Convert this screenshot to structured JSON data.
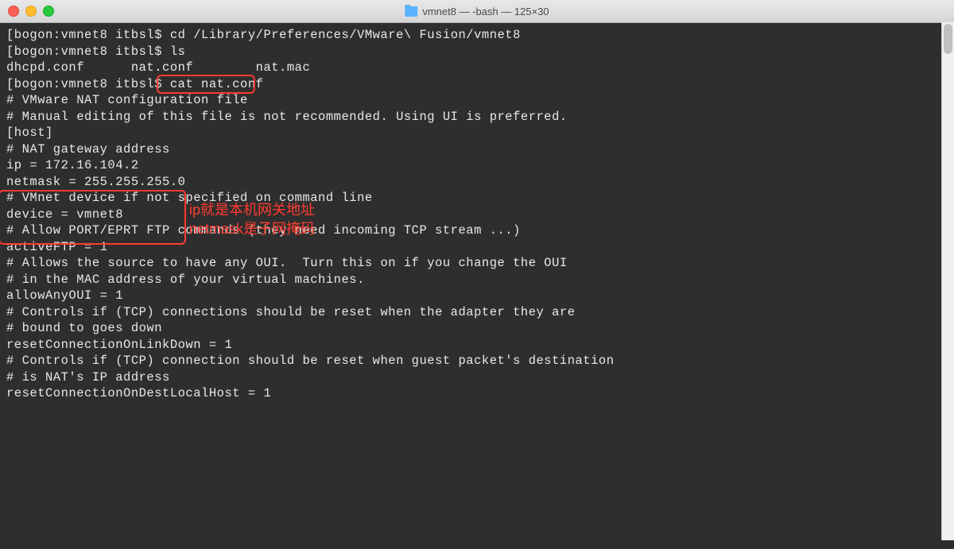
{
  "title": "vmnet8 — -bash — 125×30",
  "prompt_prefix": "[bogon:vmnet8 itbsl$ ",
  "prompt_suffix": "]",
  "commands": {
    "cd": "cd /Library/Preferences/VMware\\ Fusion/vmnet8",
    "ls": "ls",
    "cat": "cat nat.conf"
  },
  "ls_output": "dhcpd.conf      nat.conf        nat.mac",
  "file_lines": {
    "l1": "# VMware NAT configuration file",
    "l2": "# Manual editing of this file is not recommended. Using UI is preferred.",
    "l3": "",
    "l4": "[host]",
    "l5": "",
    "l6": "# NAT gateway address",
    "l7": "ip = 172.16.104.2",
    "l8": "netmask = 255.255.255.0",
    "l9": "",
    "l10": "# VMnet device if not specified on command line",
    "l11": "device = vmnet8",
    "l12": "",
    "l13": "# Allow PORT/EPRT FTP commands (they need incoming TCP stream ...)",
    "l14": "activeFTP = 1",
    "l15": "",
    "l16": "# Allows the source to have any OUI.  Turn this on if you change the OUI",
    "l17": "# in the MAC address of your virtual machines.",
    "l18": "allowAnyOUI = 1",
    "l19": "",
    "l20": "# Controls if (TCP) connections should be reset when the adapter they are",
    "l21": "# bound to goes down",
    "l22": "resetConnectionOnLinkDown = 1",
    "l23": "",
    "l24": "# Controls if (TCP) connection should be reset when guest packet's destination",
    "l25": "# is NAT's IP address",
    "l26": "resetConnectionOnDestLocalHost = 1"
  },
  "annotations": {
    "ip": "ip就是本机网关地址",
    "netmask": "netmask是子网掩码"
  }
}
